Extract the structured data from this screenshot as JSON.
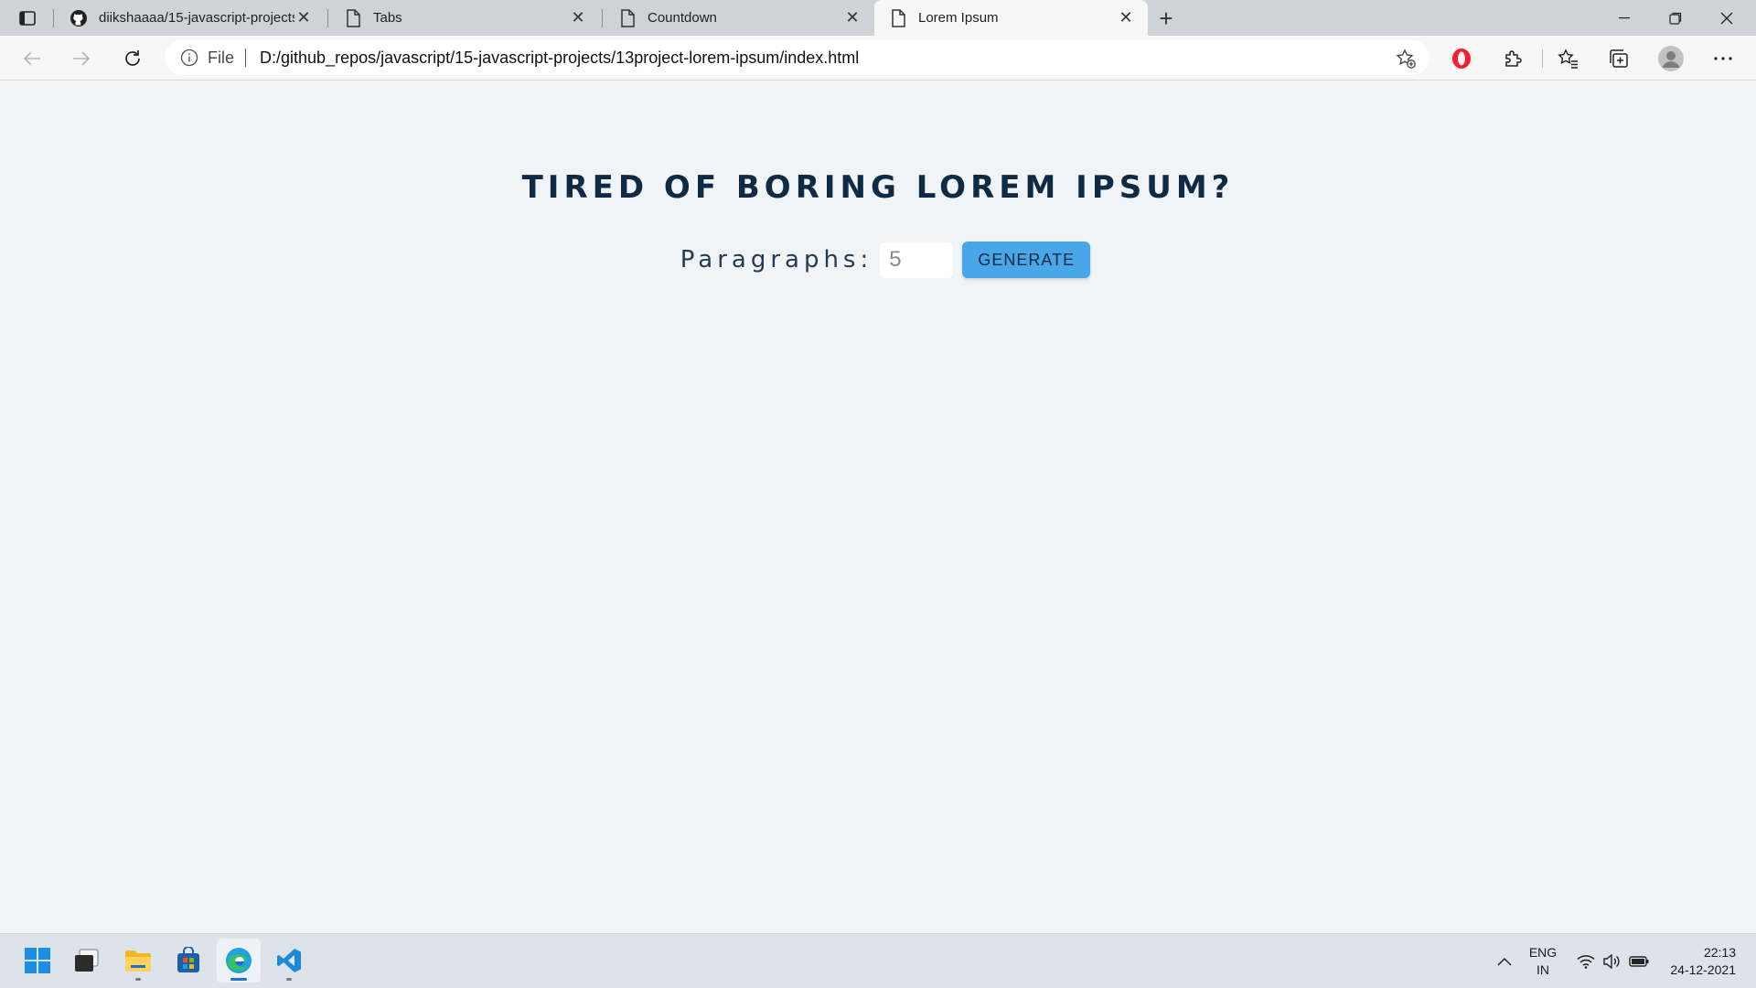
{
  "browser": {
    "tabs": [
      {
        "title": "diikshaaaa/15-javascript-projects",
        "icon": "github-icon",
        "active": false
      },
      {
        "title": "Tabs",
        "icon": "page-icon",
        "active": false
      },
      {
        "title": "Countdown",
        "icon": "page-icon",
        "active": false
      },
      {
        "title": "Lorem Ipsum",
        "icon": "page-icon",
        "active": true
      }
    ],
    "address": {
      "scheme_label": "File",
      "url": "D:/github_repos/javascript/15-javascript-projects/13project-lorem-ipsum/index.html"
    }
  },
  "page": {
    "title": "TIRED OF BORING LOREM IPSUM?",
    "paragraphs_label": "Paragraphs:",
    "amount_value": "5",
    "generate_label": "GENERATE"
  },
  "taskbar": {
    "apps": [
      "start-icon",
      "task-view-icon",
      "file-explorer-icon",
      "store-icon",
      "edge-icon",
      "vscode-icon"
    ],
    "language_line1": "ENG",
    "language_line2": "IN",
    "time": "22:13",
    "date": "24-12-2021"
  },
  "colors": {
    "accent_button": "#49a6e9",
    "title_color": "#102a43",
    "page_background": "#f1f4f7"
  }
}
